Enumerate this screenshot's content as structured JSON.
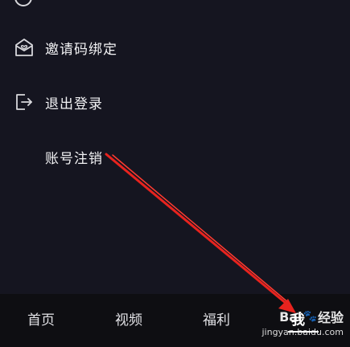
{
  "menu": {
    "items": [
      {
        "label": "邀请码绑定",
        "icon": "invite-code-icon"
      },
      {
        "label": "退出登录",
        "icon": "logout-icon"
      },
      {
        "label": "账号注销",
        "icon": ""
      }
    ]
  },
  "tab_bar": {
    "tabs": [
      {
        "label": "首页"
      },
      {
        "label": "视频"
      },
      {
        "label": "福利"
      },
      {
        "label": "我",
        "selected": true
      }
    ]
  },
  "watermark": {
    "logo_left": "Bai",
    "logo_right": "经验",
    "url": "jingyan.baidu.com"
  },
  "colors": {
    "background": "#151520",
    "tab_bar": "#0e0e12",
    "annotation_arrow": "#e8231e"
  }
}
